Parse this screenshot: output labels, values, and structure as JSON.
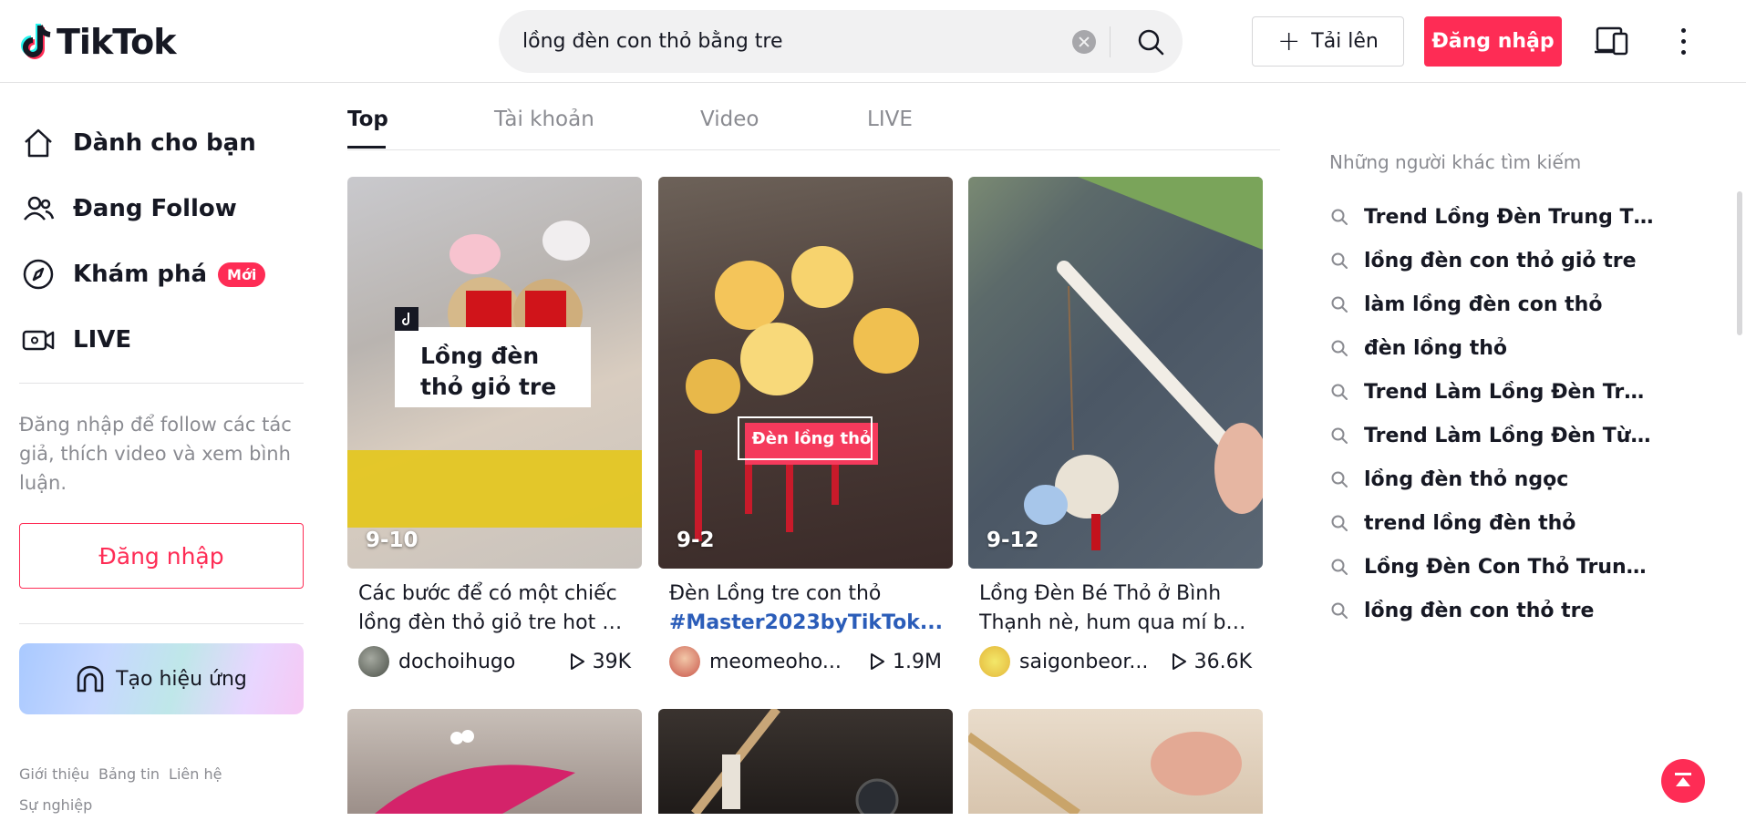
{
  "header": {
    "logo_text": "TikTok",
    "search_value": "lồng đèn con thỏ bằng tre",
    "upload_label": "Tải lên",
    "login_label": "Đăng nhập"
  },
  "sidebar": {
    "nav": [
      {
        "label": "Dành cho bạn",
        "icon": "home-icon"
      },
      {
        "label": "Đang Follow",
        "icon": "following-icon"
      },
      {
        "label": "Khám phá",
        "icon": "compass-icon",
        "badge": "Mới"
      },
      {
        "label": "LIVE",
        "icon": "live-icon"
      }
    ],
    "login_note": "Đăng nhập để follow các tác giả, thích video và xem bình luận.",
    "login_button": "Đăng nhập",
    "effect_button": "Tạo hiệu ứng",
    "footer_links": [
      "Giới thiệu",
      "Bảng tin",
      "Liên hệ",
      "Sự nghiệp"
    ]
  },
  "tabs": [
    "Top",
    "Tài khoản",
    "Video",
    "LIVE"
  ],
  "videos": [
    {
      "date": "9-10",
      "overlay_text": "Lồng đèn thỏ giỏ tre",
      "desc_line1": "Các bước để có một chiếc",
      "desc_line2": "lồng đèn thỏ giỏ tre hot hi...",
      "author": "dochoihugo",
      "plays": "39K"
    },
    {
      "date": "9-2",
      "overlay_text": "Đèn lồng thỏ",
      "desc_line1": "Đèn Lồng tre con thỏ",
      "desc_line2": "#Master2023byTikTok...",
      "author": "meomeoho...",
      "plays": "1.9M"
    },
    {
      "date": "9-12",
      "desc_line1": "Lồng Đèn Bé Thỏ ở Bình",
      "desc_line2": "Thạnh nè, hum qua mí bà...",
      "author": "saigonbeor...",
      "plays": "36.6K"
    }
  ],
  "related": {
    "title": "Những người khác tìm kiếm",
    "items": [
      "Trend Lồng Đèn Trung Thu ...",
      "lồng đèn con thỏ giỏ tre",
      "làm lồng đèn con thỏ",
      "đèn lồng thỏ",
      "Trend Làm Lồng Đèn Trung...",
      "Trend Làm Lồng Đèn Từ Ch...",
      "lồng đèn thỏ ngọc",
      "trend lồng đèn thỏ",
      "Lồng Đèn Con Thỏ Trung Thu",
      "lồng đèn con thỏ tre"
    ]
  },
  "colors": {
    "accent": "#fe2c55",
    "hashtag": "#2b5db9",
    "muted": "#8a8b91"
  }
}
